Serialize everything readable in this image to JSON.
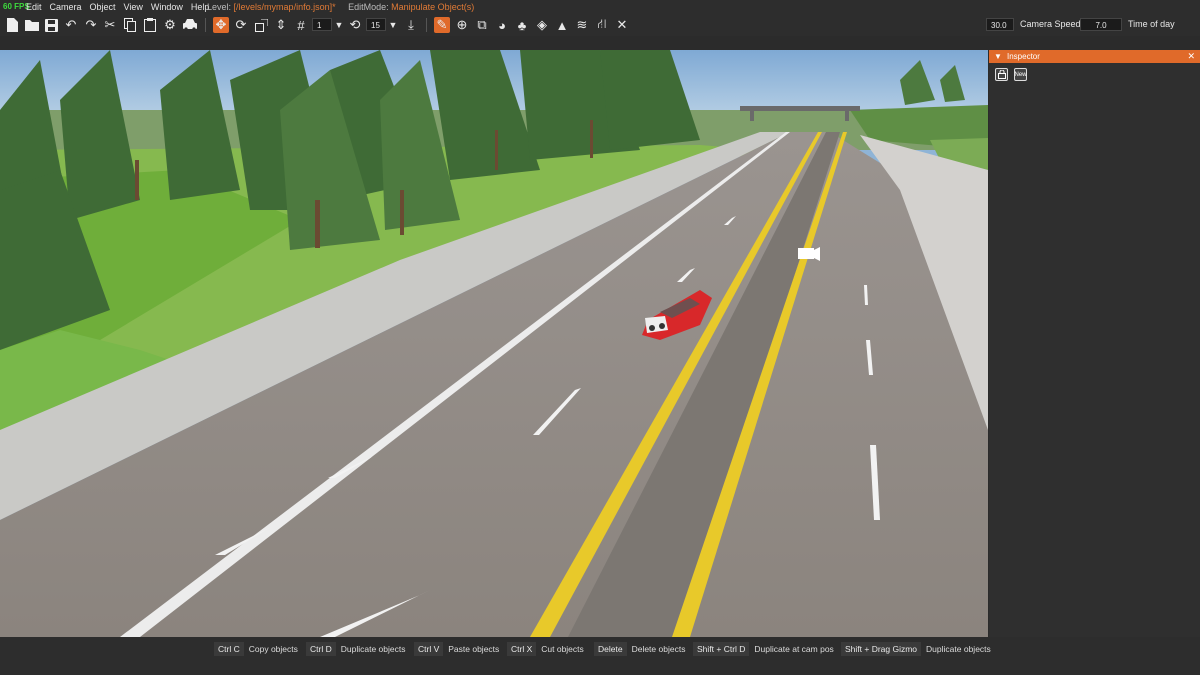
{
  "menubar": {
    "fps": "60 FPS",
    "menus": [
      "Edit",
      "Camera",
      "Object",
      "View",
      "Window",
      "Help"
    ],
    "level_label": "Level:",
    "level_value": "[/levels/mymap/info.json]*",
    "editmode_label": "EditMode:",
    "editmode_value": "Manipulate Object(s)"
  },
  "toolbar": {
    "snap_value": "1",
    "rotate_snap_value": "15",
    "camera_speed_value": "30.0",
    "camera_speed_label": "Camera Speed",
    "time_of_day_value": "7.0",
    "time_of_day_label": "Time of day"
  },
  "inspector": {
    "title": "Inspector",
    "new_label": "New"
  },
  "shortcuts": [
    {
      "key": "Ctrl C",
      "desc": "Copy objects"
    },
    {
      "key": "Ctrl D",
      "desc": "Duplicate objects"
    },
    {
      "key": "Ctrl V",
      "desc": "Paste objects"
    },
    {
      "key": "Ctrl X",
      "desc": "Cut objects"
    },
    {
      "key": "Delete",
      "desc": "Delete objects"
    },
    {
      "key": "Shift + Ctrl D",
      "desc": "Duplicate at cam pos"
    },
    {
      "key": "Shift + Drag Gizmo",
      "desc": "Duplicate objects"
    }
  ]
}
